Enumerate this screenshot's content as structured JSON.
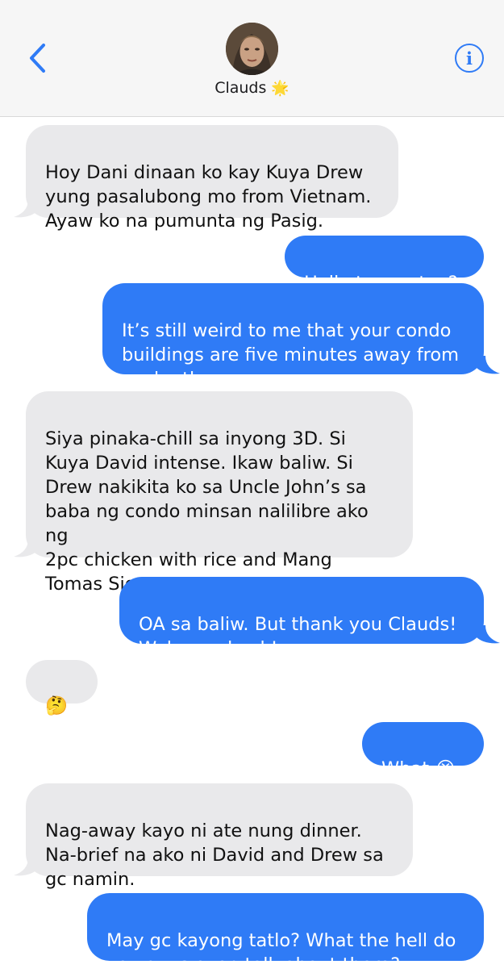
{
  "header": {
    "contact_name": "Clauds",
    "name_emoji": "🌟",
    "info_glyph": "i",
    "back_glyph": "‹"
  },
  "messages": [
    {
      "direction": "incoming",
      "text": "Hoy Dani dinaan ko kay Kuya Drew\nyung pasalubong mo from Vietnam.\nAyaw ko na pumunta ng Pasig."
    },
    {
      "direction": "outgoing",
      "text": "Hello to you too?"
    },
    {
      "direction": "outgoing",
      "text": "It’s still weird to me that your condo\nbuildings are five minutes away from\neach other"
    },
    {
      "direction": "incoming",
      "text": "Siya pinaka-chill sa inyong 3D. Si\nKuya David intense. Ikaw baliw. Si\nDrew nakikita ko sa Uncle John’s sa\nbaba ng condo minsan nalilibre ako ng\n2pc chicken with rice and Mang\nTomas Siga sauce."
    },
    {
      "direction": "outgoing",
      "text": "OA sa baliw. But thank you Clauds!\nWelcome back!"
    },
    {
      "direction": "incoming",
      "text": "🤔"
    },
    {
      "direction": "outgoing",
      "text": "What 😭"
    },
    {
      "direction": "incoming",
      "text": "Nag-away kayo ni ate nung dinner.\nNa-brief na ako ni David and Drew sa\ngc namin."
    },
    {
      "direction": "outgoing",
      "text": "May gc kayong tatlo? What the hell do\nyou guys even talk about there?"
    }
  ],
  "colors": {
    "accent": "#2f7bf6",
    "incoming_bubble": "#e9e9eb",
    "header_bg": "#f6f6f6"
  }
}
